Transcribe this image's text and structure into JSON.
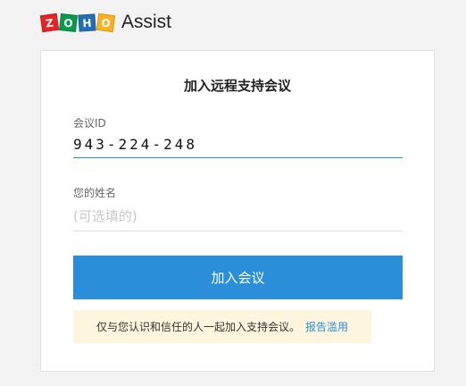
{
  "header": {
    "logo_letters": [
      "Z",
      "O",
      "H",
      "O"
    ],
    "product_name": "Assist"
  },
  "card": {
    "title": "加入远程支持会议",
    "meeting_id": {
      "label": "会议ID",
      "value": "943-224-248"
    },
    "name": {
      "label": "您的姓名",
      "placeholder": "(可选填的)"
    },
    "join_button": "加入会议",
    "notice": {
      "text": "仅与您认识和信任的人一起加入支持会议。",
      "report_link": "报告滥用"
    }
  },
  "colors": {
    "accent": "#2a8fd8",
    "notice_bg": "#fef5df"
  }
}
